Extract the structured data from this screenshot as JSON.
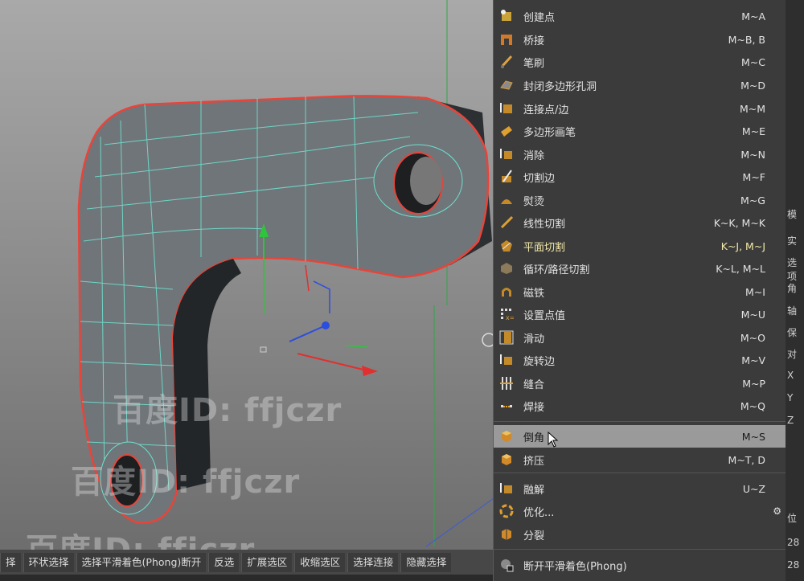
{
  "menu": {
    "items": [
      {
        "label": "创建点",
        "shortcut": "M~A",
        "icon": "create-point-icon"
      },
      {
        "label": "桥接",
        "shortcut": "M~B, B",
        "icon": "bridge-icon"
      },
      {
        "label": "笔刷",
        "shortcut": "M~C",
        "icon": "brush-icon"
      },
      {
        "label": "封闭多边形孔洞",
        "shortcut": "M~D",
        "icon": "close-polygon-hole-icon"
      },
      {
        "label": "连接点/边",
        "shortcut": "M~M",
        "icon": "connect-points-edges-icon"
      },
      {
        "label": "多边形画笔",
        "shortcut": "M~E",
        "icon": "polygon-pen-icon"
      },
      {
        "label": "消除",
        "shortcut": "M~N",
        "icon": "dissolve-icon"
      },
      {
        "label": "切割边",
        "shortcut": "M~F",
        "icon": "edge-cut-icon"
      },
      {
        "label": "熨烫",
        "shortcut": "M~G",
        "icon": "iron-icon"
      },
      {
        "label": "线性切割",
        "shortcut": "K~K, M~K",
        "icon": "line-cut-icon"
      },
      {
        "label": "平面切割",
        "shortcut": "K~J, M~J",
        "icon": "plane-cut-icon",
        "highlight": true
      },
      {
        "label": "循环/路径切割",
        "shortcut": "K~L, M~L",
        "icon": "loop-path-cut-icon"
      },
      {
        "label": "磁铁",
        "shortcut": "M~I",
        "icon": "magnet-icon"
      },
      {
        "label": "设置点值",
        "shortcut": "M~U",
        "icon": "set-point-value-icon"
      },
      {
        "label": "滑动",
        "shortcut": "M~O",
        "icon": "slide-icon"
      },
      {
        "label": "旋转边",
        "shortcut": "M~V",
        "icon": "spin-edge-icon"
      },
      {
        "label": "缝合",
        "shortcut": "M~P",
        "icon": "stitch-icon"
      },
      {
        "label": "焊接",
        "shortcut": "M~Q",
        "icon": "weld-icon"
      }
    ],
    "items2": [
      {
        "label": "倒角",
        "shortcut": "M~S",
        "icon": "bevel-icon",
        "active": true
      },
      {
        "label": "挤压",
        "shortcut": "M~T, D",
        "icon": "extrude-icon"
      }
    ],
    "items3": [
      {
        "label": "融解",
        "shortcut": "U~Z",
        "icon": "melt-icon"
      },
      {
        "label": "优化...",
        "shortcut": "",
        "icon": "optimize-icon"
      },
      {
        "label": "分裂",
        "shortcut": "",
        "icon": "split-icon"
      }
    ],
    "items4": [
      {
        "label": "断开平滑着色(Phong)",
        "shortcut": "",
        "icon": "break-phong-icon"
      }
    ]
  },
  "bottom_bar": {
    "buttons": [
      "择",
      "环状选择",
      "选择平滑着色(Phong)断开",
      "反选",
      "扩展选区",
      "收缩选区",
      "选择连接",
      "隐藏选择"
    ]
  },
  "watermarks": [
    "百度ID: ffjczr",
    "百度ID: ffjczr",
    "百度ID: ffjczr"
  ],
  "right_panel": {
    "labels": [
      "模",
      "实",
      "选项",
      "角",
      "轴",
      "保",
      "对",
      "X",
      "Y",
      "Z",
      "位",
      "28",
      "28"
    ]
  },
  "colors": {
    "menu_bg": "#3b3b3b",
    "active_bg": "#9a9a9a",
    "highlight_text": "#f3e9a8",
    "mesh_wire": "#6fe0cf",
    "mesh_border": "#e8443a",
    "mesh_face": "#6f7579"
  }
}
